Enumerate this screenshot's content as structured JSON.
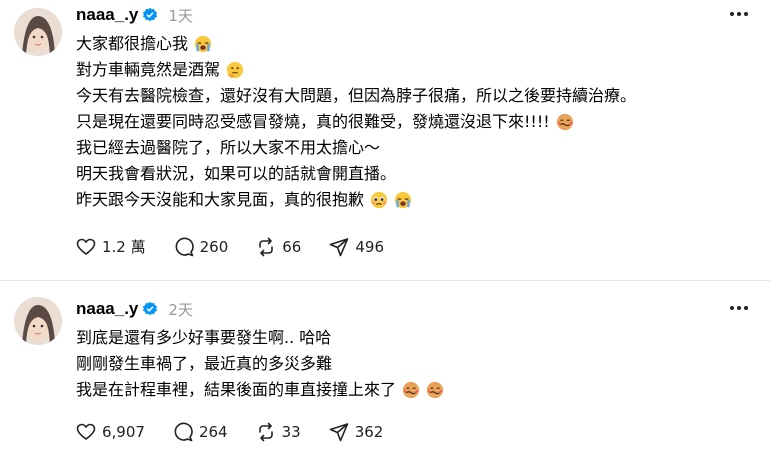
{
  "posts": [
    {
      "username": "naaa_.y",
      "time": "1天",
      "lines": [
        {
          "text": "大家都很擔心我",
          "emojis": [
            "crying-face"
          ]
        },
        {
          "text": "對方車輛竟然是酒駕",
          "emojis": [
            "thinking-face"
          ]
        },
        {
          "text": "今天有去醫院檢查，還好沒有大問題，但因為脖子很痛，所以之後要持續治療。",
          "emojis": []
        },
        {
          "text": "只是現在還要同時忍受感冒發燒，真的很難受，發燒還沒退下來!!!!",
          "emojis": [
            "nauseated-face"
          ]
        },
        {
          "text": "我已經去過醫院了，所以大家不用太擔心～",
          "emojis": []
        },
        {
          "text": "明天我會看狀況，如果可以的話就會開直播。",
          "emojis": []
        },
        {
          "text": "昨天跟今天沒能和大家見面，真的很抱歉",
          "emojis": [
            "pleading-face",
            "crying-face"
          ]
        }
      ],
      "likes": "1.2 萬",
      "comments": "260",
      "reposts": "66",
      "shares": "496"
    },
    {
      "username": "naaa_.y",
      "time": "2天",
      "lines": [
        {
          "text": "到底是還有多少好事要發生啊.. 哈哈",
          "emojis": []
        },
        {
          "text": "剛剛發生車禍了，最近真的多災多難",
          "emojis": []
        },
        {
          "text": "我是在計程車裡，結果後面的車直接撞上來了",
          "emojis": [
            "nauseated-face",
            "nauseated-face"
          ]
        }
      ],
      "likes": "6,907",
      "comments": "264",
      "reposts": "33",
      "shares": "362"
    }
  ]
}
